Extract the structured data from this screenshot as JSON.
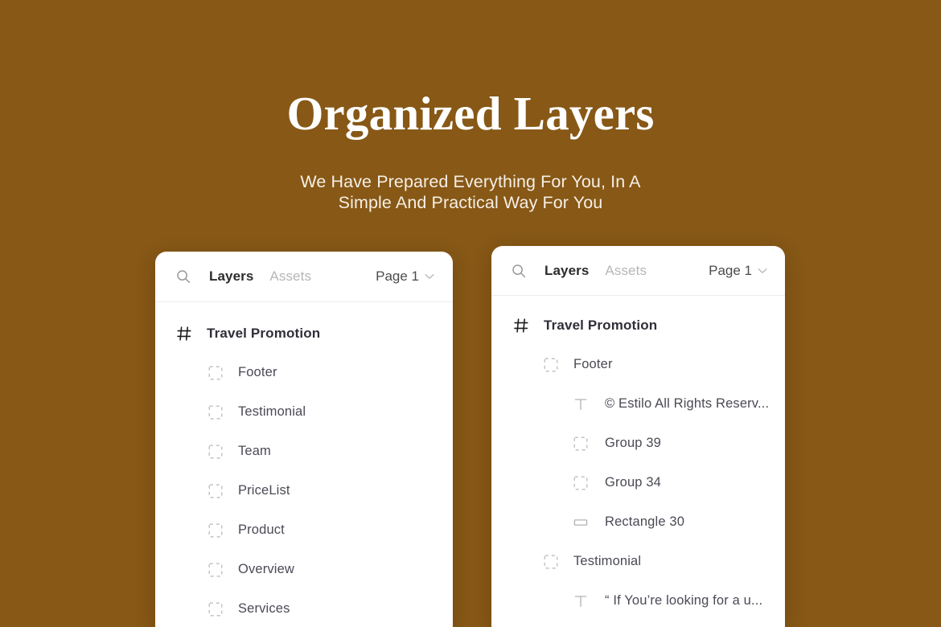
{
  "theme": {
    "background": "#875816",
    "panel_background": "#ffffff",
    "title_color": "#ffffff",
    "subtitle_color": "#f6efe6",
    "label_color": "#4a4a55",
    "active_tab_color": "#2c2c2c",
    "inactive_tab_color": "#b6b6b6"
  },
  "hero": {
    "title": "Organized Layers",
    "subtitle_line1": "We Have Prepared Everything For You, In A",
    "subtitle_line2": "Simple And Practical Way For You"
  },
  "panels": {
    "left": {
      "header": {
        "search_icon": "search-icon",
        "tab_active": "Layers",
        "tab_inactive": "Assets",
        "page_label": "Page 1",
        "chevron_icon": "chevron-down-icon"
      },
      "layers": [
        {
          "label": "Travel Promotion",
          "icon": "page-hash-icon",
          "depth": 0,
          "root": true
        },
        {
          "label": "Footer",
          "icon": "frame-icon",
          "depth": 1
        },
        {
          "label": "Testimonial",
          "icon": "frame-icon",
          "depth": 1
        },
        {
          "label": "Team",
          "icon": "frame-icon",
          "depth": 1
        },
        {
          "label": "PriceList",
          "icon": "frame-icon",
          "depth": 1
        },
        {
          "label": "Product",
          "icon": "frame-icon",
          "depth": 1
        },
        {
          "label": "Overview",
          "icon": "frame-icon",
          "depth": 1
        },
        {
          "label": "Services",
          "icon": "frame-icon",
          "depth": 1
        }
      ]
    },
    "right": {
      "header": {
        "search_icon": "search-icon",
        "tab_active": "Layers",
        "tab_inactive": "Assets",
        "page_label": "Page 1",
        "chevron_icon": "chevron-down-icon"
      },
      "layers": [
        {
          "label": "Travel Promotion",
          "icon": "page-hash-icon",
          "depth": 0,
          "root": true
        },
        {
          "label": "Footer",
          "icon": "frame-icon",
          "depth": 1
        },
        {
          "label": "© Estilo All Rights Reserv...",
          "icon": "text-icon",
          "depth": 2
        },
        {
          "label": "Group 39",
          "icon": "frame-icon",
          "depth": 2
        },
        {
          "label": "Group 34",
          "icon": "frame-icon",
          "depth": 2
        },
        {
          "label": "Rectangle 30",
          "icon": "rectangle-icon",
          "depth": 2
        },
        {
          "label": "Testimonial",
          "icon": "frame-icon",
          "depth": 1
        },
        {
          "label": "“ If You’re looking for a u...",
          "icon": "text-icon",
          "depth": 2
        }
      ]
    }
  }
}
